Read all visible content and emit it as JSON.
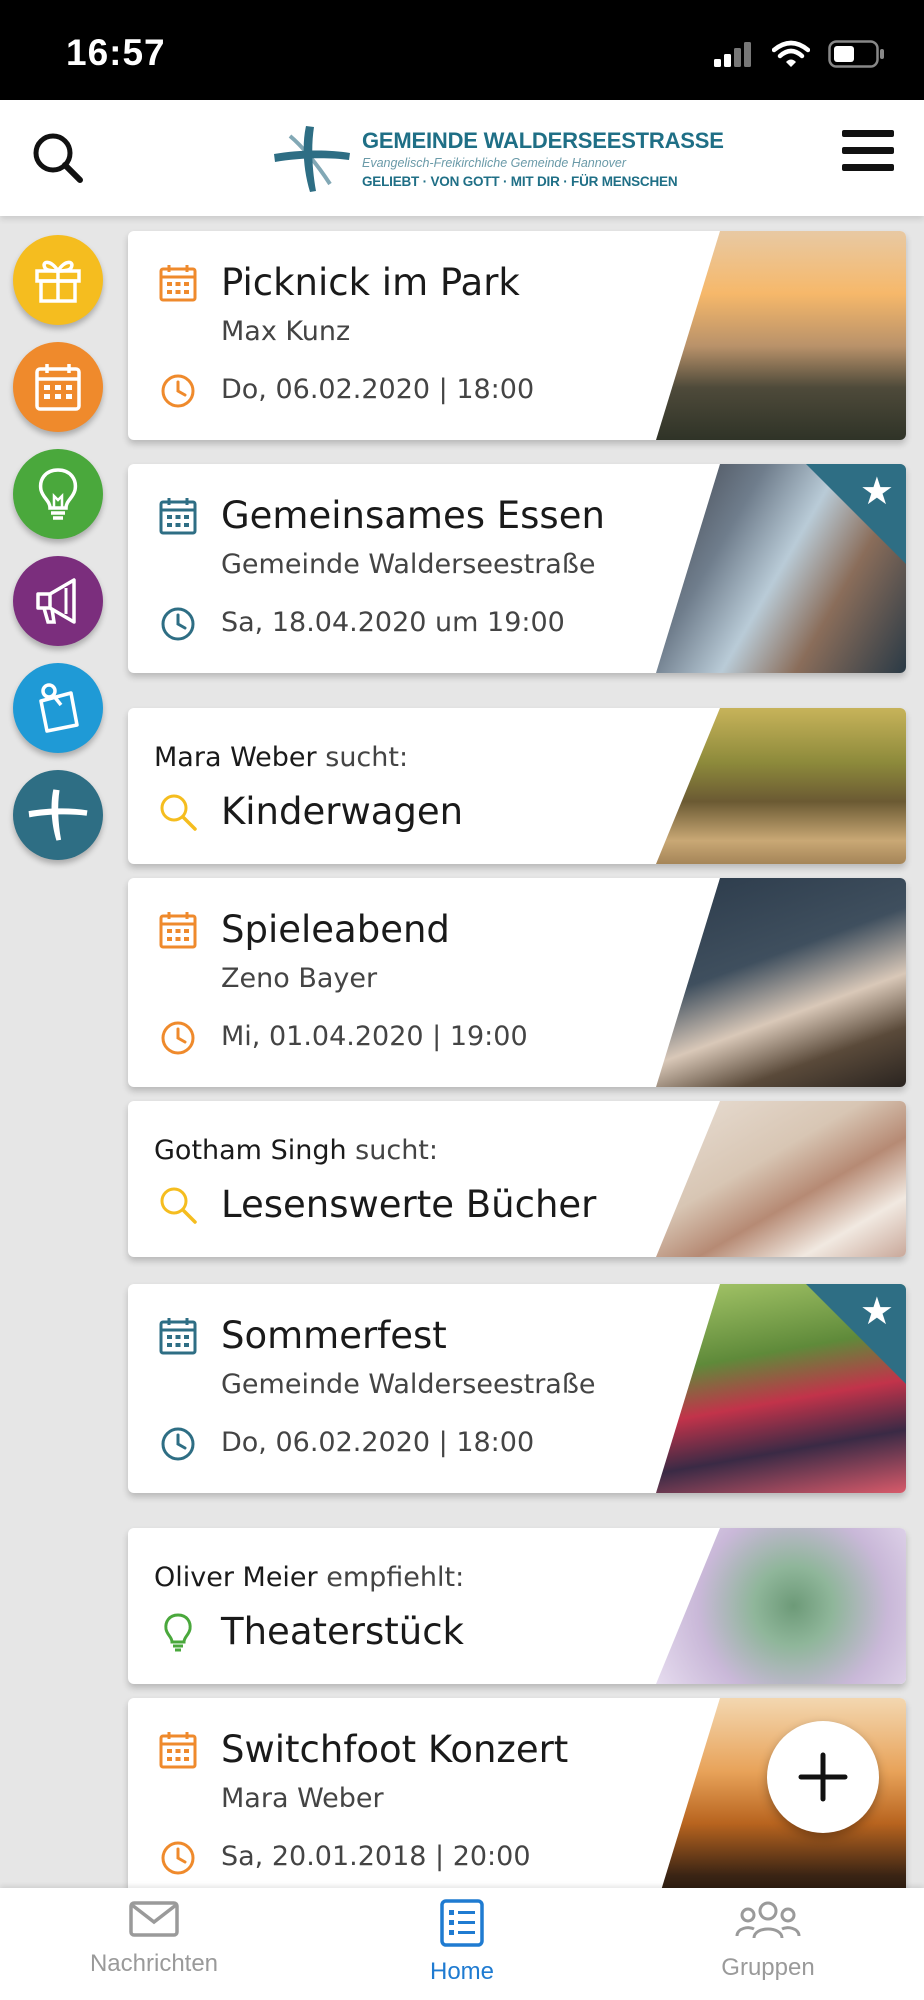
{
  "status_bar": {
    "time": "16:57",
    "icons": [
      "signal-icon",
      "wifi-icon",
      "battery-icon"
    ]
  },
  "header": {
    "logo_name": "GEMEINDE WALDERSEESTRASSE",
    "logo_subtitle": "Evangelisch-Freikirchliche Gemeinde Hannover",
    "logo_motto": "GELIEBT · VON GOTT · MIT DIR · FÜR MENSCHEN",
    "icons": {
      "left": "search-icon",
      "right": "hamburger-menu-icon"
    }
  },
  "categories": [
    {
      "icon": "gift-icon",
      "color": "#f5bd1f"
    },
    {
      "icon": "calendar-icon",
      "color": "#ef8a2c"
    },
    {
      "icon": "lightbulb-icon",
      "color": "#4aa83c"
    },
    {
      "icon": "megaphone-icon",
      "color": "#7b2e7d"
    },
    {
      "icon": "pin-note-icon",
      "color": "#1f9ad6"
    },
    {
      "icon": "cross-logo-icon",
      "color": "#2e6e84"
    }
  ],
  "feed": [
    {
      "type": "event",
      "title": "Picknick im Park",
      "organizer": "Max Kunz",
      "when": "Do, 06.02.2020 | 18:00",
      "accent": "#ef8a2c",
      "starred": false
    },
    {
      "type": "event",
      "title": "Gemeinsames Essen",
      "organizer": "Gemeinde Walderseestraße",
      "when": "Sa, 18.04.2020 um 19:00",
      "accent": "#2e6e84",
      "starred": true
    },
    {
      "type": "search",
      "person": "Mara Weber",
      "verb": "sucht:",
      "title": "Kinderwagen",
      "accent": "#f5bd1f"
    },
    {
      "type": "event",
      "title": "Spieleabend",
      "organizer": "Zeno Bayer",
      "when": "Mi, 01.04.2020 | 19:00",
      "accent": "#ef8a2c",
      "starred": false
    },
    {
      "type": "search",
      "person": "Gotham Singh",
      "verb": "sucht:",
      "title": "Lesenswerte Bücher",
      "accent": "#f5bd1f"
    },
    {
      "type": "event",
      "title": "Sommerfest",
      "organizer": "Gemeinde Walderseestraße",
      "when": "Do, 06.02.2020 | 18:00",
      "accent": "#2e6e84",
      "starred": true
    },
    {
      "type": "recommend",
      "person": "Oliver Meier",
      "verb": "empfiehlt:",
      "title": "Theaterstück",
      "accent": "#4aa83c"
    },
    {
      "type": "event",
      "title": "Switchfoot Konzert",
      "organizer": "Mara Weber",
      "when": "Sa, 20.01.2018 | 20:00",
      "accent": "#ef8a2c",
      "starred": false
    }
  ],
  "fab": {
    "icon": "plus-icon"
  },
  "bottom_nav": [
    {
      "label": "Nachrichten",
      "icon": "envelope-icon",
      "active": false
    },
    {
      "label": "Home",
      "icon": "list-icon",
      "active": true
    },
    {
      "label": "Gruppen",
      "icon": "group-icon",
      "active": false
    }
  ],
  "colors": {
    "brand": "#1f6f86",
    "active_nav": "#1f7bd1",
    "inactive_nav": "#9a9a9a"
  }
}
